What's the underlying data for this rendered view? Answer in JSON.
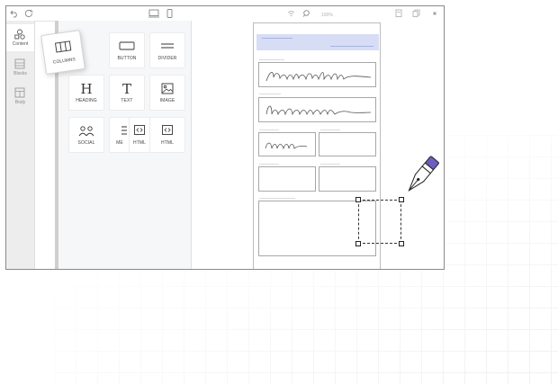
{
  "sidebar": {
    "items": [
      {
        "label": "Content",
        "icon": "shapes-icon",
        "active": true
      },
      {
        "label": "Blocks",
        "icon": "blocks-icon",
        "active": false
      },
      {
        "label": "Body",
        "icon": "layout-icon",
        "active": false
      }
    ]
  },
  "content_panel": {
    "dragging_tile": {
      "label": "COLUMNS",
      "icon": "columns-icon"
    },
    "tiles": [
      {
        "label": "BUTTON",
        "icon": "button-icon"
      },
      {
        "label": "DIVIDER",
        "icon": "divider-icon"
      },
      {
        "label": "HEADING",
        "icon": "heading-icon",
        "glyph": "H"
      },
      {
        "label": "TEXT",
        "icon": "text-icon",
        "glyph": "T"
      },
      {
        "label": "IMAGE",
        "icon": "image-icon"
      },
      {
        "label": "SOCIAL",
        "icon": "social-icon"
      },
      {
        "label": "ME",
        "icon": "menu-icon"
      },
      {
        "label": "HTML",
        "icon": "html-icon"
      },
      {
        "label": "HTML",
        "icon": "html-icon"
      }
    ]
  },
  "toolbar": {
    "zoom_label": "100%"
  },
  "colors": {
    "header_band": "#d7ddf5",
    "pen_accent": "#6a5fc1"
  }
}
